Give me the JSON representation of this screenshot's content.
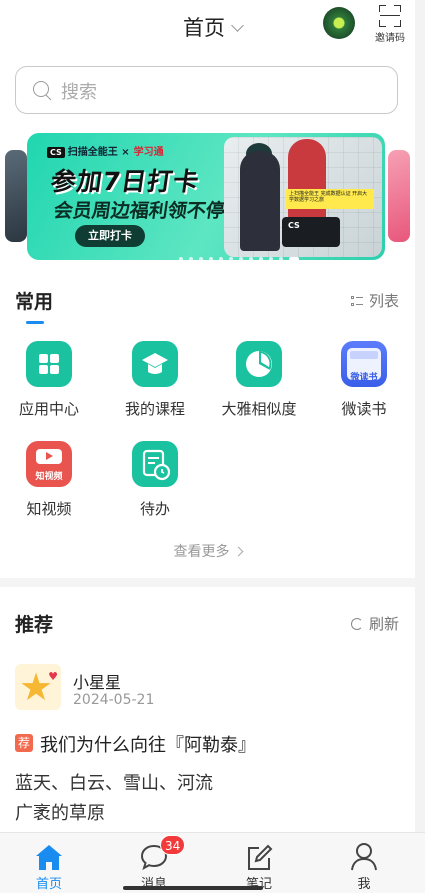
{
  "header": {
    "title": "首页",
    "invite_label": "邀请码"
  },
  "search": {
    "placeholder": "搜索"
  },
  "banner": {
    "brand": "扫描全能王",
    "brand_sep": "×",
    "partner": "学习通",
    "line1": "参加7日打卡",
    "line2": "会员周边福利领不停",
    "button": "立即打卡",
    "card_text": "CS",
    "note_text": "上扫描全能王 完成数据认证 开启大学数据学习之旅",
    "dots_total": 12,
    "active_dot_index": 11
  },
  "common": {
    "title": "常用",
    "list_label": "列表",
    "apps": [
      {
        "label": "应用中心",
        "icon": "grid-icon",
        "color": "#1ac29f"
      },
      {
        "label": "我的课程",
        "icon": "graduation-cap-icon",
        "color": "#1ac29f"
      },
      {
        "label": "大雅相似度",
        "icon": "pie-chart-icon",
        "color": "#1ac29f"
      },
      {
        "label": "微读书",
        "icon": "book-icon",
        "color": "#4a6cf5",
        "icon_text": "微读书"
      },
      {
        "label": "知视频",
        "icon": "video-icon",
        "color": "#e9544e",
        "icon_text": "知视频"
      },
      {
        "label": "待办",
        "icon": "todo-clock-icon",
        "color": "#1ac29f"
      }
    ],
    "more_label": "查看更多"
  },
  "recommend": {
    "title": "推荐",
    "refresh_label": "刷新",
    "post": {
      "user": "小星星",
      "date": "2024-05-21",
      "tag": "荐",
      "title": "我们为什么向往『阿勒泰』",
      "lines": [
        "蓝天、白云、雪山、河流",
        "广袤的草原"
      ]
    }
  },
  "tabbar": {
    "items": [
      {
        "label": "首页",
        "icon": "home-icon",
        "active": true
      },
      {
        "label": "消息",
        "icon": "message-icon",
        "active": false,
        "badge": "34"
      },
      {
        "label": "笔记",
        "icon": "note-edit-icon",
        "active": false
      },
      {
        "label": "我",
        "icon": "user-icon",
        "active": false
      }
    ]
  },
  "colors": {
    "accent": "#1a8cf0",
    "teal": "#1ac29f",
    "badge": "#f23a3a"
  }
}
